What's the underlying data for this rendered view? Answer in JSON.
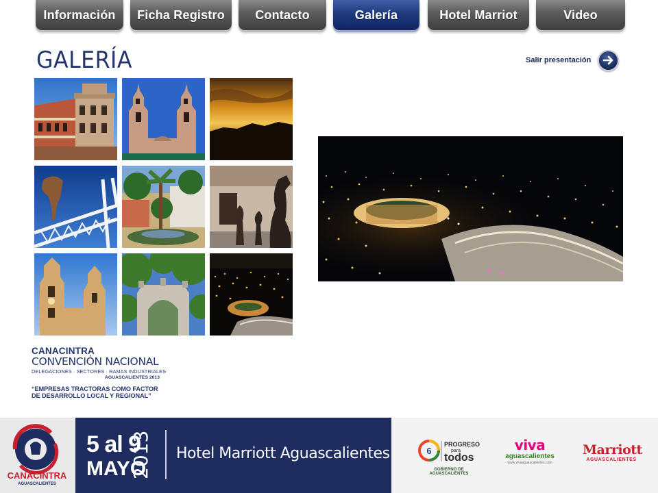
{
  "nav": {
    "tabs": [
      {
        "label": "Información",
        "active": false
      },
      {
        "label": "Ficha Registro",
        "active": false
      },
      {
        "label": "Contacto",
        "active": false
      },
      {
        "label": "Galería",
        "active": true
      },
      {
        "label": "Hotel Marriot",
        "active": false
      },
      {
        "label": "Video",
        "active": false
      }
    ]
  },
  "gallery": {
    "title": "GALERÍA",
    "exit_label": "Salir presentación",
    "exit_icon": "arrow-right-icon",
    "thumbnails": [
      {
        "subject": "colonial building with tower"
      },
      {
        "subject": "cathedral twin towers"
      },
      {
        "subject": "sunset over mountains"
      },
      {
        "subject": "sculpture and white metal structure"
      },
      {
        "subject": "plaza with palm trees"
      },
      {
        "subject": "bronze sculptures in courtyard"
      },
      {
        "subject": "church bell towers"
      },
      {
        "subject": "stone arch with trees"
      },
      {
        "subject": "city at night"
      }
    ],
    "preview": {
      "subject": "city lights at night with illuminated stadium"
    }
  },
  "event": {
    "organization": "CANACINTRA",
    "name": "CONVENCIÓN NACIONAL",
    "subtitle": "DELEGACIONES · SECTORES · RAMAS INDUSTRIALES",
    "location": "AGUASCALIENTES 2013",
    "slogan_line1": "“EMPRESAS TRACTORAS COMO FACTOR",
    "slogan_line2": "DE DESARROLLO LOCAL Y REGIONAL”"
  },
  "footer": {
    "logo_name": "CANACINTRA",
    "logo_sub": "AGUASCALIENTES",
    "date": "5 al 9",
    "month": "MAYO",
    "year": "2013",
    "venue": "Hotel Marriott Aguascalientes",
    "sponsors": {
      "progreso_line1": "PROGRESO",
      "progreso_line2": "para",
      "progreso_line3": "todos",
      "progreso_caption": "GOBIERNO DE AGUASCALIENTES",
      "viva": "viva",
      "viva_sub": "aguascalientes",
      "viva_url": "www.vivaaguascalientes.com",
      "marriott": "Marriott",
      "marriott_sub": "AGUASCALIENTES"
    },
    "colors": {
      "navy": "#1e2c60",
      "red": "#c8202f"
    }
  }
}
